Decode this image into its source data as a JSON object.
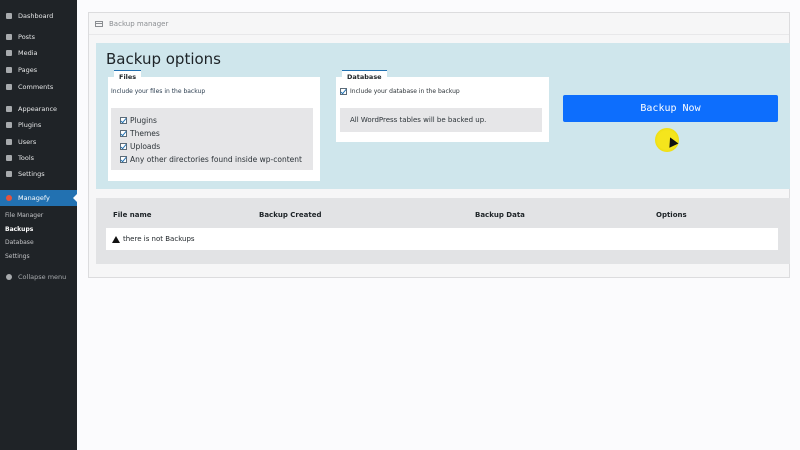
{
  "sidebar": {
    "items": [
      {
        "label": "Dashboard",
        "icon": "dashboard-icon"
      },
      {
        "label": "Posts",
        "icon": "pin-icon"
      },
      {
        "label": "Media",
        "icon": "media-icon"
      },
      {
        "label": "Pages",
        "icon": "pages-icon"
      },
      {
        "label": "Comments",
        "icon": "comments-icon"
      },
      {
        "label": "Appearance",
        "icon": "brush-icon"
      },
      {
        "label": "Plugins",
        "icon": "plugin-icon"
      },
      {
        "label": "Users",
        "icon": "users-icon"
      },
      {
        "label": "Tools",
        "icon": "wrench-icon"
      },
      {
        "label": "Settings",
        "icon": "settings-icon"
      },
      {
        "label": "Managefy",
        "icon": "managefy-icon"
      }
    ],
    "submenu": [
      "File Manager",
      "Backups",
      "Database",
      "Settings"
    ],
    "current_sub": "Backups",
    "collapse_label": "Collapse menu"
  },
  "header": {
    "title": "Backup manager"
  },
  "options": {
    "title": "Backup options",
    "files": {
      "title": "Files",
      "include_label": "Include your files in the backup",
      "checks": [
        "Plugins",
        "Themes",
        "Uploads",
        "Any other directories found inside wp-content"
      ]
    },
    "database": {
      "title": "Database",
      "include_label": "Include your database in the backup",
      "note": "All WordPress tables will be backed up."
    },
    "backup_button": "Backup Now"
  },
  "table": {
    "headers": [
      "File name",
      "Backup Created",
      "Backup Data",
      "Options"
    ],
    "empty_message": "there is not Backups"
  },
  "colors": {
    "accent": "#2271b1",
    "button": "#0d6efd",
    "options_bg": "#cfe6ec",
    "sidebar": "#1f2327"
  }
}
